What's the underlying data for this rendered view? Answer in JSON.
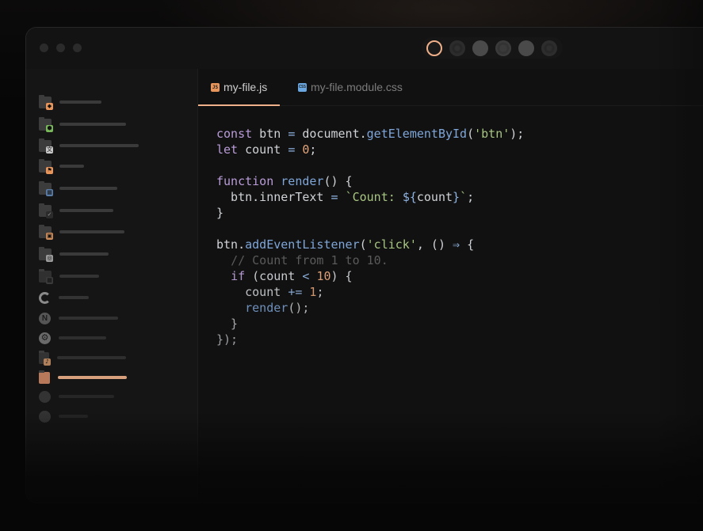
{
  "window": {
    "traffic_lights": [
      "close",
      "minimize",
      "zoom"
    ]
  },
  "theme_picker": {
    "swatches": [
      {
        "name": "theme-swatch-1",
        "selected": true
      },
      {
        "name": "theme-swatch-2",
        "selected": false
      },
      {
        "name": "theme-swatch-3",
        "selected": false
      },
      {
        "name": "theme-swatch-4",
        "selected": false
      },
      {
        "name": "theme-swatch-5",
        "selected": false
      },
      {
        "name": "theme-swatch-6",
        "selected": false
      }
    ],
    "accent_color": "#f0b089"
  },
  "sidebar": {
    "items": [
      {
        "icon": "folder-git-icon",
        "active": false
      },
      {
        "icon": "folder-node-icon",
        "active": false
      },
      {
        "icon": "folder-translate-icon",
        "active": false
      },
      {
        "icon": "folder-flag-icon",
        "active": false
      },
      {
        "icon": "folder-grid-icon",
        "active": false
      },
      {
        "icon": "folder-check-icon",
        "active": false
      },
      {
        "icon": "folder-package-icon",
        "active": false
      },
      {
        "icon": "folder-settings-icon",
        "active": false
      },
      {
        "icon": "folder-apps-icon",
        "active": false
      },
      {
        "icon": "arc-logo-icon",
        "active": false
      },
      {
        "icon": "nextjs-logo-icon",
        "active": false
      },
      {
        "icon": "gear-icon",
        "active": false
      },
      {
        "icon": "file-music-icon",
        "active": false
      },
      {
        "icon": "file-js-icon",
        "active": true
      },
      {
        "icon": "file-circle-icon",
        "active": false
      },
      {
        "icon": "file-circle-check-icon",
        "active": false
      }
    ]
  },
  "tabs": [
    {
      "label": "my-file.js",
      "icon": "js-file-icon",
      "icon_text": "JS",
      "active": true
    },
    {
      "label": "my-file.module.css",
      "icon": "css-file-icon",
      "icon_text": "CSS",
      "active": false
    }
  ],
  "code": {
    "language": "javascript",
    "lines": [
      "const btn = document.getElementById('btn');",
      "let count = 0;",
      "",
      "function render() {",
      "  btn.innerText = `Count: ${count}`;",
      "}",
      "",
      "btn.addEventListener('click', () ⇒ {",
      "  // Count from 1 to 10.",
      "  if (count < 10) {",
      "    count += 1;",
      "    render();",
      "  }",
      "});"
    ]
  },
  "colors": {
    "keyword": "#b99cd8",
    "function": "#7fa6d9",
    "string": "#a8c683",
    "number": "#e4a57a",
    "comment": "#5a5a5a",
    "text": "#cfd2d6"
  }
}
